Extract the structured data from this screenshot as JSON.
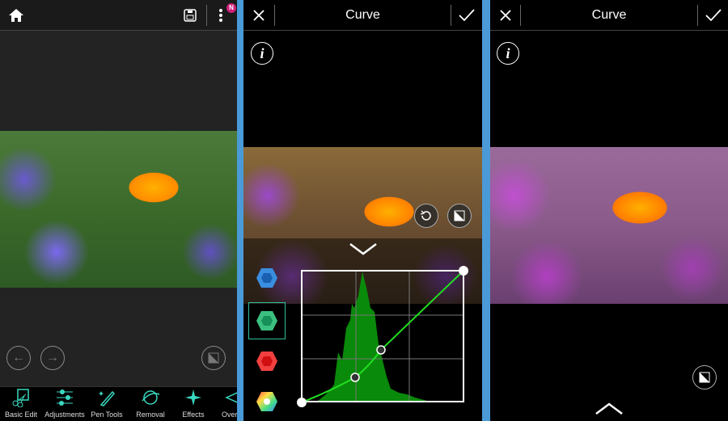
{
  "editor": {
    "toolbar": [
      {
        "label": "Basic Edit",
        "icon": "basic-edit-icon"
      },
      {
        "label": "Adjustments",
        "icon": "sliders-icon"
      },
      {
        "label": "Pen Tools",
        "icon": "pen-icon"
      },
      {
        "label": "Removal",
        "icon": "removal-icon"
      },
      {
        "label": "Effects",
        "icon": "sparkle-icon"
      },
      {
        "label": "Overlay",
        "icon": "layers-icon"
      }
    ],
    "badge": "N"
  },
  "curve_panel": {
    "title": "Curve",
    "channels": [
      "blue",
      "green",
      "red",
      "rgb"
    ],
    "selected_channel": "green",
    "curve_color": "#22dd22"
  },
  "result_panel": {
    "title": "Curve"
  },
  "colors": {
    "accent": "#4a9ad8",
    "selection": "#2fbf9a"
  }
}
